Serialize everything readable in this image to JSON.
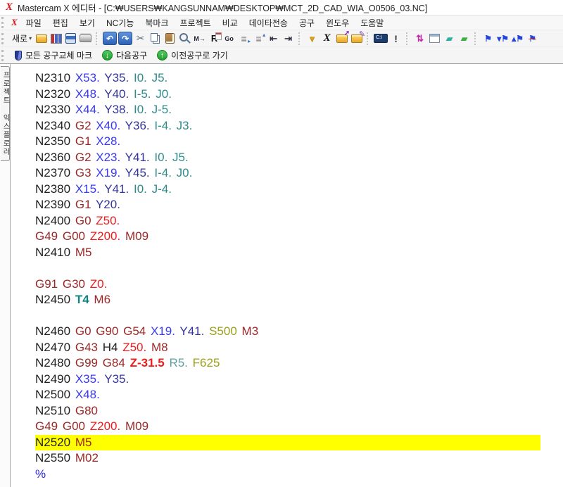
{
  "window": {
    "title": "Mastercam X 에디터 - [C:₩USERS₩KANGSUNNAM₩DESKTOP₩MCT_2D_CAD_WIA_O0506_03.NC]"
  },
  "menu": {
    "items": [
      "파일",
      "편집",
      "보기",
      "NC기능",
      "북마크",
      "프로젝트",
      "비교",
      "데이타전송",
      "공구",
      "윈도우",
      "도움말"
    ]
  },
  "toolbar_main": {
    "new_label": "새로",
    "new_caret": "▾",
    "icons": [
      {
        "name": "open-folder-icon",
        "cls": "folder"
      },
      {
        "name": "file-grid-icon",
        "cls": "grid"
      },
      {
        "name": "save-icon",
        "cls": "save"
      },
      {
        "name": "print-icon",
        "cls": "print"
      },
      {
        "sep": true
      },
      {
        "name": "undo-icon",
        "glyph": "↶",
        "cls": "bluebtn"
      },
      {
        "name": "redo-icon",
        "glyph": "↷",
        "cls": "bluebtn"
      },
      {
        "name": "cut-icon",
        "glyph": "✂",
        "cls": "plainscis"
      },
      {
        "name": "copy-icon",
        "cls": "copy"
      },
      {
        "name": "paste-icon",
        "cls": "paste"
      },
      {
        "name": "find-icon",
        "cls": "magnifier"
      },
      {
        "name": "find-next-icon",
        "glyph": "M→",
        "cls": "tinytext"
      },
      {
        "name": "replace-icon",
        "glyph": "R",
        "cls": "replace"
      },
      {
        "name": "goto-line-icon",
        "glyph": "Go",
        "cls": "tinytext"
      },
      {
        "name": "mark-next-icon",
        "glyph": "≡",
        "cls": "marklines"
      },
      {
        "name": "mark-prev-icon",
        "glyph": "≡",
        "cls": "marklines2"
      },
      {
        "name": "outdent-icon",
        "glyph": "⇤",
        "cls": "indent"
      },
      {
        "name": "indent-icon",
        "glyph": "⇥",
        "cls": "indent"
      },
      {
        "sep": true
      },
      {
        "name": "filter-icon",
        "glyph": "▼",
        "cls": "funnel"
      },
      {
        "name": "mastercam-x-icon",
        "glyph": "X",
        "cls": "mcx"
      },
      {
        "name": "folder-export-icon",
        "cls": "folder folder-up"
      },
      {
        "name": "folder-edit-icon",
        "cls": "folder folder-edit"
      },
      {
        "sep": true
      },
      {
        "name": "console-icon",
        "glyph": "C:\\",
        "cls": "console"
      },
      {
        "name": "syntax-check-icon",
        "glyph": "!",
        "cls": "bang"
      },
      {
        "sep": true
      },
      {
        "name": "compare-icon",
        "glyph": "⇅",
        "cls": "compare"
      },
      {
        "name": "send-window-icon",
        "cls": "winarrow"
      },
      {
        "name": "eraser-teal-icon",
        "glyph": "▰",
        "cls": "er1"
      },
      {
        "name": "eraser-green-icon",
        "glyph": "▰",
        "cls": "er2"
      },
      {
        "sep": true
      },
      {
        "name": "bookmark-toggle-icon",
        "glyph": "⚑",
        "cls": "pen"
      },
      {
        "name": "bookmark-next-icon",
        "glyph": "▾⚑",
        "cls": "pen"
      },
      {
        "name": "bookmark-prev-icon",
        "glyph": "▴⚑",
        "cls": "pen"
      },
      {
        "name": "bookmark-clear-icon",
        "glyph": "⚑",
        "cls": "penx"
      }
    ]
  },
  "toolbar_tools": {
    "buttons": [
      {
        "name": "all-toolchange-marks-button",
        "icon": "shield-icon",
        "icon_cls": "shield",
        "icon_glyph": "",
        "label": "모든 공구교체 마크"
      },
      {
        "name": "next-tool-button",
        "icon": "arrow-down-circle-icon",
        "icon_cls": "gcirc",
        "icon_glyph": "↓",
        "label": "다음공구"
      },
      {
        "name": "prev-tool-button",
        "icon": "arrow-up-circle-icon",
        "icon_cls": "gcirc",
        "icon_glyph": "↑",
        "label": "이전공구로 가기"
      }
    ]
  },
  "sidebar": {
    "tab_label": "프로젝트 익스플로러"
  },
  "editor": {
    "highlight_color": "#ffff00",
    "colors": {
      "n": "#1f1f1f",
      "g": "#9c2727",
      "x": "#3a3aef",
      "y": "#34349c",
      "ij": "#2e8b8b",
      "z": "#ee1c1c",
      "t": "#0e8585",
      "sf": "#9aa019",
      "r": "#5f9ea0",
      "pct": "#2929dd"
    },
    "lines": [
      {
        "tokens": [
          {
            "t": "N2310",
            "c": "n"
          },
          {
            "t": "X53.",
            "c": "x"
          },
          {
            "t": "Y35.",
            "c": "y"
          },
          {
            "t": "I0. J5.",
            "c": "ij"
          }
        ]
      },
      {
        "tokens": [
          {
            "t": "N2320",
            "c": "n"
          },
          {
            "t": "X48.",
            "c": "x"
          },
          {
            "t": "Y40.",
            "c": "y"
          },
          {
            "t": "I-5. J0.",
            "c": "ij"
          }
        ]
      },
      {
        "tokens": [
          {
            "t": "N2330",
            "c": "n"
          },
          {
            "t": "X44.",
            "c": "x"
          },
          {
            "t": "Y38.",
            "c": "y"
          },
          {
            "t": "I0. J-5.",
            "c": "ij"
          }
        ]
      },
      {
        "tokens": [
          {
            "t": "N2340",
            "c": "n"
          },
          {
            "t": "G2",
            "c": "g"
          },
          {
            "t": "X40.",
            "c": "x"
          },
          {
            "t": "Y36.",
            "c": "y"
          },
          {
            "t": "I-4. J3.",
            "c": "ij"
          }
        ]
      },
      {
        "tokens": [
          {
            "t": "N2350",
            "c": "n"
          },
          {
            "t": "G1",
            "c": "g"
          },
          {
            "t": "X28.",
            "c": "x"
          }
        ]
      },
      {
        "tokens": [
          {
            "t": "N2360",
            "c": "n"
          },
          {
            "t": "G2",
            "c": "g"
          },
          {
            "t": "X23.",
            "c": "x"
          },
          {
            "t": "Y41.",
            "c": "y"
          },
          {
            "t": "I0. J5.",
            "c": "ij"
          }
        ]
      },
      {
        "tokens": [
          {
            "t": "N2370",
            "c": "n"
          },
          {
            "t": "G3",
            "c": "g"
          },
          {
            "t": "X19.",
            "c": "x"
          },
          {
            "t": "Y45.",
            "c": "y"
          },
          {
            "t": "I-4. J0.",
            "c": "ij"
          }
        ]
      },
      {
        "tokens": [
          {
            "t": "N2380",
            "c": "n"
          },
          {
            "t": "X15.",
            "c": "x"
          },
          {
            "t": "Y41.",
            "c": "y"
          },
          {
            "t": "I0. J-4.",
            "c": "ij"
          }
        ]
      },
      {
        "tokens": [
          {
            "t": "N2390",
            "c": "n"
          },
          {
            "t": "G1",
            "c": "g"
          },
          {
            "t": "Y20.",
            "c": "y"
          }
        ]
      },
      {
        "tokens": [
          {
            "t": "N2400",
            "c": "n"
          },
          {
            "t": "G0",
            "c": "g"
          },
          {
            "t": "Z50.",
            "c": "z"
          }
        ]
      },
      {
        "tokens": [
          {
            "t": "G49 G00",
            "c": "g"
          },
          {
            "t": "Z200.",
            "c": "z"
          },
          {
            "t": "M09",
            "c": "g"
          }
        ]
      },
      {
        "tokens": [
          {
            "t": "N2410",
            "c": "n"
          },
          {
            "t": "M5",
            "c": "g"
          }
        ]
      },
      {
        "tokens": []
      },
      {
        "tokens": [
          {
            "t": "G91 G30",
            "c": "g"
          },
          {
            "t": "Z0.",
            "c": "z"
          }
        ]
      },
      {
        "tokens": [
          {
            "t": "N2450",
            "c": "n"
          },
          {
            "t": "T4",
            "c": "t",
            "b": true
          },
          {
            "t": "M6",
            "c": "g"
          }
        ]
      },
      {
        "tokens": []
      },
      {
        "tokens": [
          {
            "t": "N2460",
            "c": "n"
          },
          {
            "t": "G0 G90 G54",
            "c": "g"
          },
          {
            "t": "X19.",
            "c": "x"
          },
          {
            "t": "Y41.",
            "c": "y"
          },
          {
            "t": "S500",
            "c": "sf"
          },
          {
            "t": "M3",
            "c": "g"
          }
        ]
      },
      {
        "tokens": [
          {
            "t": "N2470",
            "c": "n"
          },
          {
            "t": "G43",
            "c": "g"
          },
          {
            "t": "H4",
            "c": "n"
          },
          {
            "t": "Z50.",
            "c": "z"
          },
          {
            "t": "M8",
            "c": "g"
          }
        ]
      },
      {
        "tokens": [
          {
            "t": "N2480",
            "c": "n"
          },
          {
            "t": "G99 G84",
            "c": "g"
          },
          {
            "t": "Z-31.5",
            "c": "z",
            "b": true
          },
          {
            "t": "R5.",
            "c": "r"
          },
          {
            "t": "F625",
            "c": "sf"
          }
        ]
      },
      {
        "tokens": [
          {
            "t": "N2490",
            "c": "n"
          },
          {
            "t": "X35.",
            "c": "x"
          },
          {
            "t": "Y35.",
            "c": "y"
          }
        ]
      },
      {
        "tokens": [
          {
            "t": "N2500",
            "c": "n"
          },
          {
            "t": "X48.",
            "c": "x"
          }
        ]
      },
      {
        "tokens": [
          {
            "t": "N2510",
            "c": "n"
          },
          {
            "t": "G80",
            "c": "g"
          }
        ]
      },
      {
        "tokens": [
          {
            "t": "G49 G00",
            "c": "g"
          },
          {
            "t": "Z200.",
            "c": "z"
          },
          {
            "t": "M09",
            "c": "g"
          }
        ]
      },
      {
        "tokens": [
          {
            "t": "N2520",
            "c": "n"
          },
          {
            "t": "M5",
            "c": "g"
          }
        ],
        "hl": true
      },
      {
        "tokens": [
          {
            "t": "N2550",
            "c": "n"
          },
          {
            "t": "M02",
            "c": "g"
          }
        ]
      },
      {
        "tokens": [
          {
            "t": "%",
            "c": "pct"
          }
        ]
      }
    ]
  }
}
